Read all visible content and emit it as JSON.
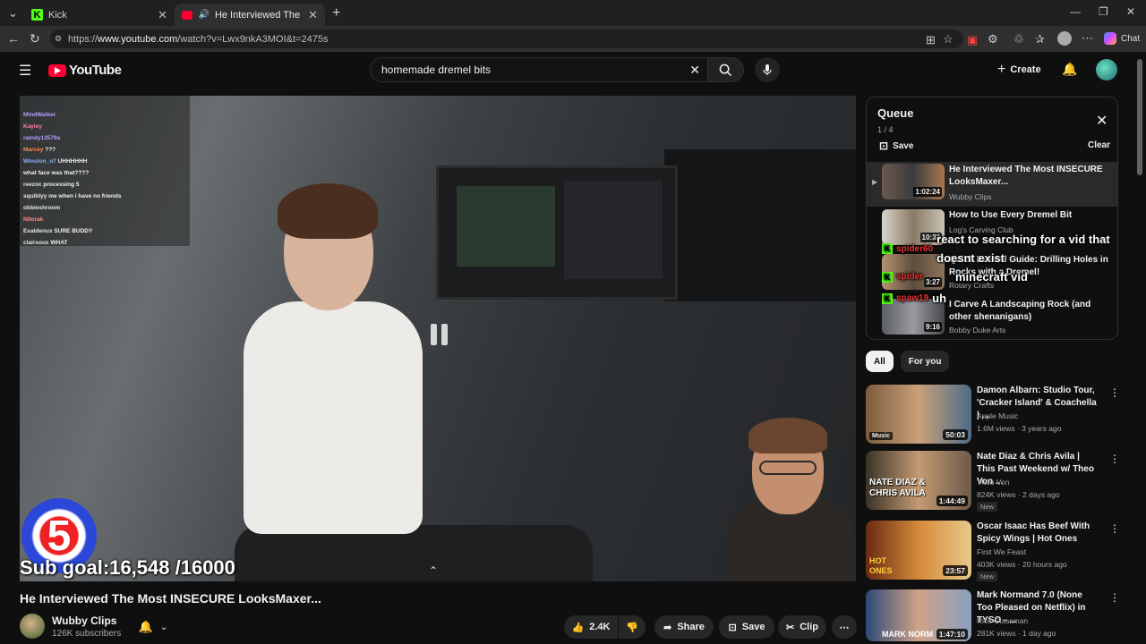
{
  "browser": {
    "tabs": [
      {
        "label": "Kick"
      },
      {
        "label": "He Interviewed The Most INSE..."
      }
    ],
    "url_prefix": "https://",
    "url_host": "www.youtube.com",
    "url_path": "/watch?v=Lwx9nkA3MOI&t=2475s",
    "chat_label": "Chat"
  },
  "header": {
    "logo": "YouTube",
    "search_value": "homemade dremel bits",
    "create_label": "Create"
  },
  "player": {
    "chat_lines": [
      {
        "user": "",
        "msg": ""
      },
      {
        "user": "MindWalker",
        "msg": ""
      },
      {
        "user": "Kayley",
        "msg": ""
      },
      {
        "user": "ramdy13579a",
        "msg": ""
      },
      {
        "user": "Marcey",
        "msg": "???"
      },
      {
        "user": "Winston_o7",
        "msg": "UHHHHHH"
      },
      {
        "user": "",
        "msg": "what face was that????"
      },
      {
        "user": "reezoc",
        "msg": "processing 5"
      },
      {
        "user": "squiblyy",
        "msg": "me when i have no friends"
      },
      {
        "user": "obbieshroom",
        "msg": ""
      },
      {
        "user": "Nitorak",
        "msg": ""
      },
      {
        "user": "Exaldenux",
        "msg": "SURE BUDDY"
      },
      {
        "user": "clairsoux",
        "msg": "WHAT"
      }
    ],
    "badge_number": "5",
    "sub_goal": "Sub goal:16,548 /16000"
  },
  "video": {
    "title": "He Interviewed The Most INSECURE LooksMaxer...",
    "channel": "Wubby Clips",
    "subscribers": "126K subscribers",
    "likes": "2.4K",
    "share_label": "Share",
    "save_label": "Save",
    "clip_label": "Clip"
  },
  "queue": {
    "title": "Queue",
    "count": "1 / 4",
    "save_label": "Save",
    "clear_label": "Clear",
    "items": [
      {
        "title": "He Interviewed The Most INSECURE LooksMaxer...",
        "channel": "Wubby Clips",
        "duration": "1:02:24"
      },
      {
        "title": "How to Use Every Dremel Bit",
        "channel": "Log's Carving Club",
        "duration": "10:32"
      },
      {
        "title": "Quick Dremel Guide: Drilling Holes in Rocks with a Dremel!",
        "channel": "Rotary Crafts",
        "duration": "3:27"
      },
      {
        "title": "I Carve A Landscaping Rock (and other shenanigans)",
        "channel": "Bobby Duke Arts",
        "duration": "9:16"
      }
    ]
  },
  "kick_overlay": [
    {
      "name": "spider60",
      "text": "react to searching for a vid that doesnt exist"
    },
    {
      "name": "spider",
      "text": "minecraft vid"
    },
    {
      "name": "spaw19",
      "text": "uh"
    }
  ],
  "chips": [
    {
      "label": "All"
    },
    {
      "label": "For you"
    }
  ],
  "recommendations": [
    {
      "title": "Damon Albarn: Studio Tour, 'Cracker Island' & Coachella | ...",
      "channel": "Apple Music",
      "meta": "1.6M views · 3 years ago",
      "duration": "50:03",
      "tag": "Music",
      "new": ""
    },
    {
      "title": "Nate Diaz & Chris Avila | This Past Weekend w/ Theo Von ...",
      "channel": "Theo Von",
      "meta": "824K views · 2 days ago",
      "duration": "1:44:49",
      "thumb_text": "NATE DIAZ & CHRIS AVILA",
      "new": "New"
    },
    {
      "title": "Oscar Isaac Has Beef With Spicy Wings | Hot Ones",
      "channel": "First We Feast",
      "meta": "403K views · 20 hours ago",
      "duration": "23:57",
      "thumb_text": "HOT ONES",
      "new": "New"
    },
    {
      "title": "Mark Normand 7.0 (None Too Pleased on Netflix) in TYSO - ...",
      "channel": "Rick Glassman",
      "meta": "281K views · 1 day ago",
      "duration": "1:47:10",
      "thumb_text": "MARK NORM",
      "new": ""
    }
  ]
}
